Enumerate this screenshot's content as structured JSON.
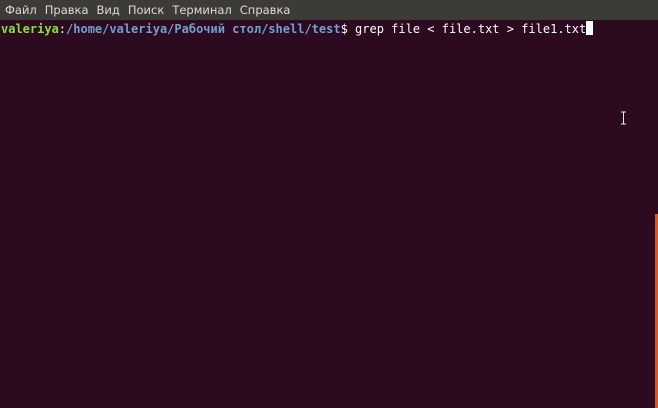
{
  "menubar": {
    "items": [
      "Файл",
      "Правка",
      "Вид",
      "Поиск",
      "Терминал",
      "Справка"
    ]
  },
  "terminal": {
    "prompt_user": "valeriya",
    "prompt_colon": ":",
    "prompt_path": "/home/valeriya/Рабочий стол/shell/test",
    "prompt_symbol": "$",
    "command": " grep file < file.txt > file1.txt"
  },
  "colors": {
    "background": "#2c0a1f",
    "menubar": "#3c3b37",
    "user": "#8ae234",
    "path": "#729fcf",
    "accent": "#d45a2a"
  },
  "icons": {
    "text_cursor": "i-beam-cursor-icon"
  }
}
